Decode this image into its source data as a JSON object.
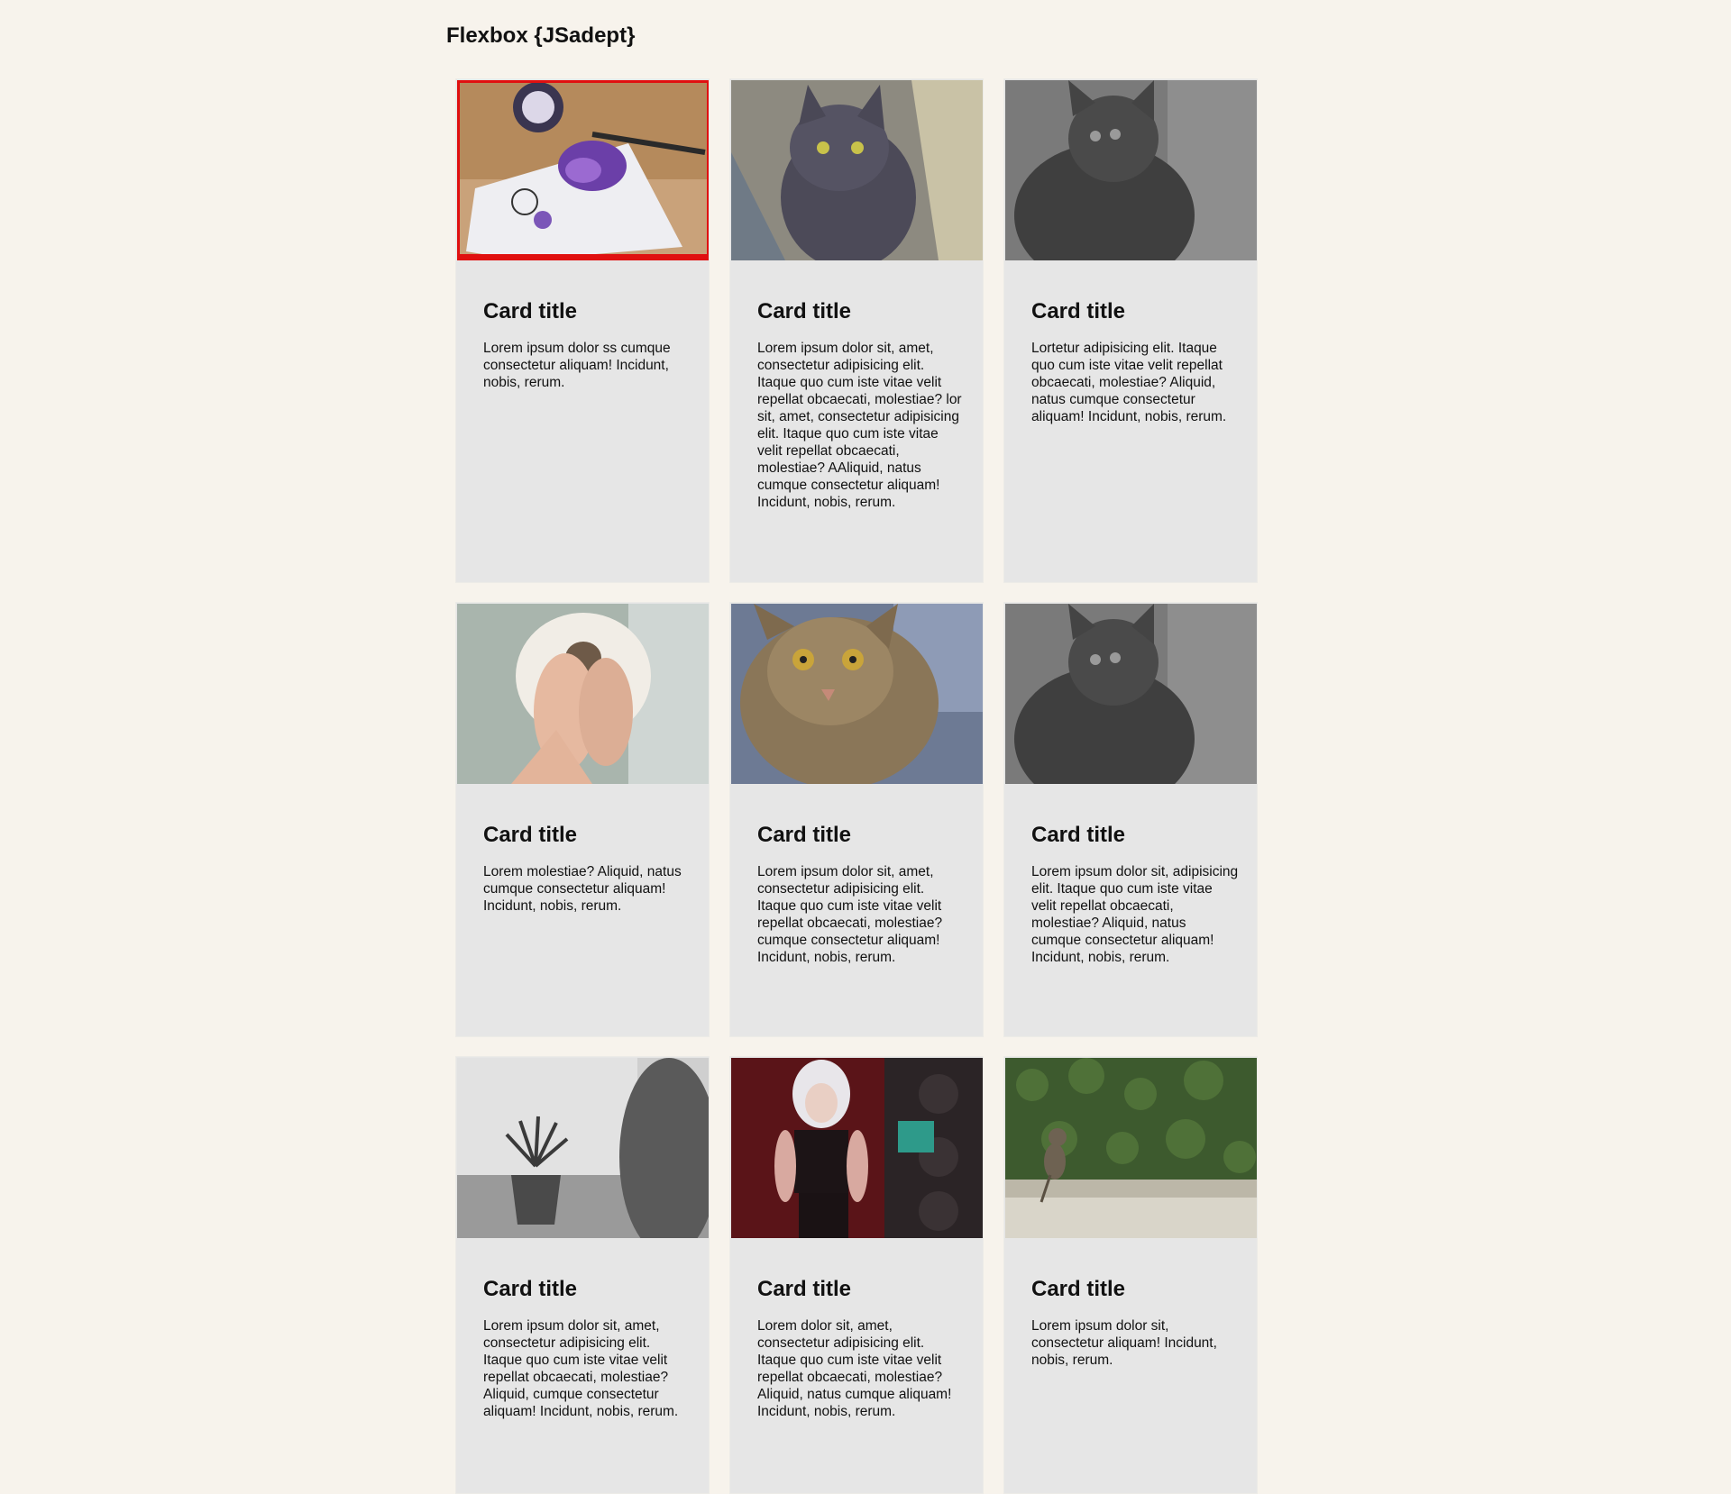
{
  "header": {
    "title": "Flexbox {JSadept}"
  },
  "cards": [
    {
      "title": "Card title",
      "text": "Lorem ipsum dolor ss cumque consectetur aliquam! Incidunt, nobis, rerum.",
      "image": "art-supplies-photo"
    },
    {
      "title": "Card title",
      "text": "Lorem ipsum dolor sit, amet, consectetur adipisicing elit. Itaque quo cum iste vitae velit repellat obcaecati, molestiae? lor sit, amet, consectetur adipisicing elit. Itaque quo cum iste vitae velit repellat obcaecati, molestiae? AAliquid, natus cumque consectetur aliquam! Incidunt, nobis, rerum.",
      "image": "gray-cat-photo"
    },
    {
      "title": "Card title",
      "text": "Lortetur adipisicing elit. Itaque quo cum iste vitae velit repellat obcaecati, molestiae? Aliquid, natus cumque consectetur aliquam! Incidunt, nobis, rerum.",
      "image": "bw-cat-photo"
    },
    {
      "title": "Card title",
      "text": "Lorem molestiae? Aliquid, natus cumque consectetur aliquam! Incidunt, nobis, rerum.",
      "image": "kitten-hands-photo"
    },
    {
      "title": "Card title",
      "text": "Lorem ipsum dolor sit, amet, consectetur adipisicing elit. Itaque quo cum iste vitae velit repellat obcaecati, molestiae? cumque consectetur aliquam! Incidunt, nobis, rerum.",
      "image": "tabby-cat-photo"
    },
    {
      "title": "Card title",
      "text": "Lorem ipsum dolor sit, adipisicing elit. Itaque quo cum iste vitae velit repellat obcaecati, molestiae? Aliquid, natus cumque consectetur aliquam! Incidunt, nobis, rerum.",
      "image": "bw-cat-photo"
    },
    {
      "title": "Card title",
      "text": "Lorem ipsum dolor sit, amet, consectetur adipisicing elit. Itaque quo cum iste vitae velit repellat obcaecati, molestiae? Aliquid, cumque consectetur aliquam! Incidunt, nobis, rerum.",
      "image": "cat-window-plant-photo"
    },
    {
      "title": "Card title",
      "text": "Lorem dolor sit, amet, consectetur adipisicing elit. Itaque quo cum iste vitae velit repellat obcaecati, molestiae? Aliquid, natus cumque aliquam! Incidunt, nobis, rerum.",
      "image": "game-character-photo"
    },
    {
      "title": "Card title",
      "text": "Lorem ipsum dolor sit, consectetur aliquam! Incidunt, nobis, rerum.",
      "image": "cat-on-wall-photo"
    }
  ],
  "colors": {
    "background": "#f7f3ec",
    "card": "#e6e6e6",
    "selected_outline": "#e01010"
  }
}
